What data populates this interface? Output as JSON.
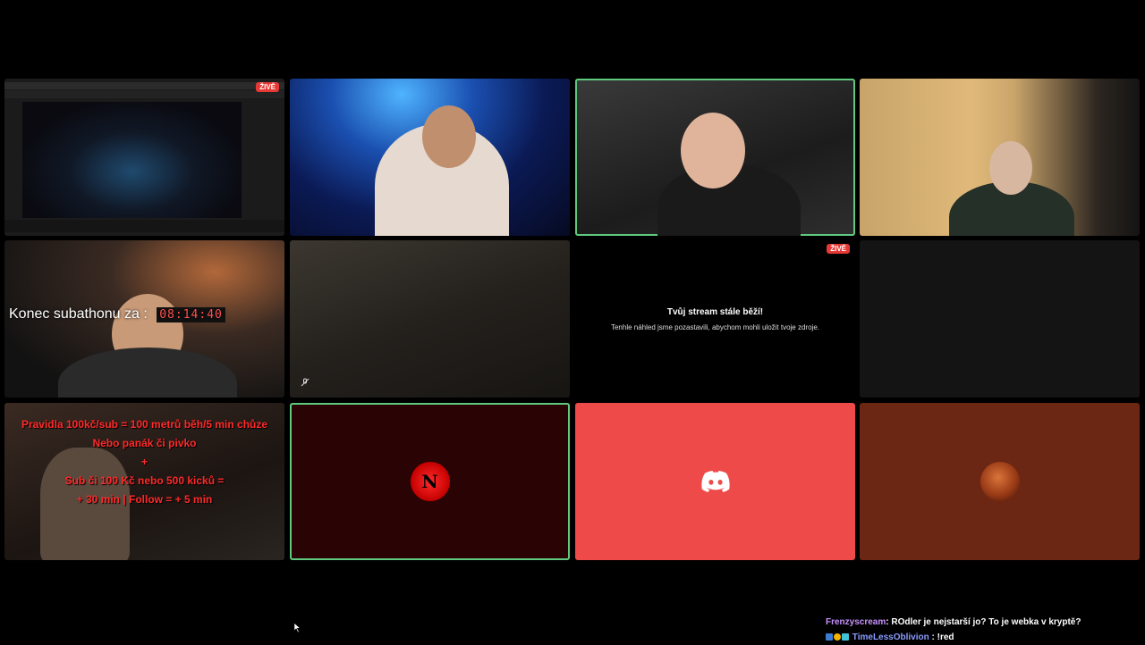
{
  "tiles": {
    "screen_share": {
      "live_badge": "ŽIVĚ"
    },
    "paused": {
      "live_badge": "ŽIVĚ",
      "title": "Tvůj stream stále běží!",
      "subtitle": "Tenhle náhled jsme pozastavili, abychom mohli uložit tvoje zdroje."
    },
    "subathon": {
      "label": "Konec subathonu za :",
      "time": "08:14:40"
    },
    "rules": {
      "lines": [
        "Pravidla 100kč/sub = 100 metrů běh/5 min chůze",
        "Nebo panák či pivko",
        "+",
        "Sub či 100 Kč nebo 500 kicků =",
        "+ 30 min | Follow = + 5 min"
      ]
    },
    "netflix_logo": "N"
  },
  "chat": [
    {
      "user": "Frenzyscream",
      "sep": ": ",
      "message": "ROdler je nejstarší jo? To je webka v kryptě?"
    },
    {
      "user": "TimeLessOblivion",
      "sep": " : ",
      "message": "!red"
    }
  ],
  "colors": {
    "live": "#e53935",
    "active_border": "#5fc97e",
    "discord": "#ef4a4a",
    "rules_text": "#ff2a2a"
  }
}
